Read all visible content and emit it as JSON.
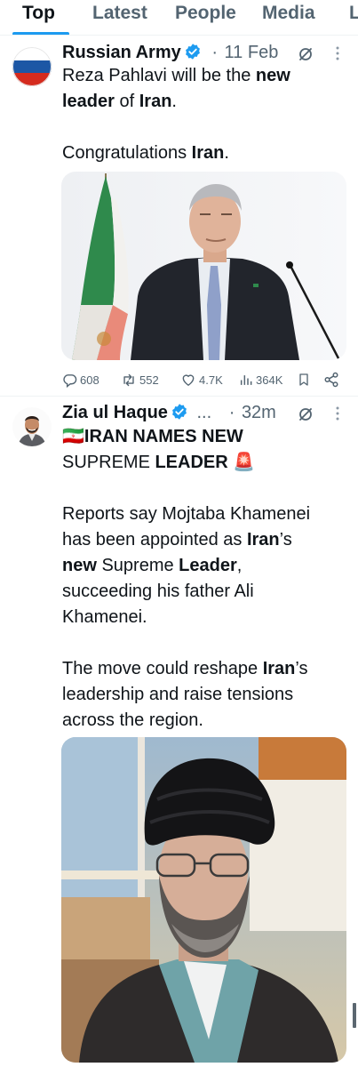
{
  "tabs": [
    {
      "label": "Top",
      "active": true
    },
    {
      "label": "Latest",
      "active": false
    },
    {
      "label": "People",
      "active": false
    },
    {
      "label": "Media",
      "active": false
    },
    {
      "label": "L",
      "active": false
    }
  ],
  "tweets": [
    {
      "author": "Russian Army",
      "verified": true,
      "separator": "·",
      "time": "11 Feb",
      "avatar": "russian-flag-avatar",
      "text_lines": [
        [
          {
            "t": "Reza Pahlavi will be the "
          },
          {
            "t": "new",
            "b": true
          }
        ],
        [
          {
            "t": "leader",
            "b": true
          },
          {
            "t": " of "
          },
          {
            "t": "Iran",
            "b": true
          },
          {
            "t": "."
          }
        ],
        [],
        [
          {
            "t": "Congratulations "
          },
          {
            "t": "Iran",
            "b": true
          },
          {
            "t": "."
          }
        ]
      ],
      "media": "photo-man-in-suit-at-podium-with-iranian-flag",
      "actions": {
        "replies": "608",
        "reposts": "552",
        "likes": "4.7K",
        "views": "364K"
      }
    },
    {
      "author": "Zia ul Haque",
      "verified": true,
      "truncation": "...",
      "separator": "·",
      "time": "32m",
      "avatar": "man-with-beard-avatar",
      "text_lines": [
        [
          {
            "t": "🇮🇷"
          },
          {
            "t": "IRAN NAMES NEW",
            "b": true
          }
        ],
        [
          {
            "t": "SUPREME "
          },
          {
            "t": "LEADER",
            "b": true
          },
          {
            "t": " 🚨"
          }
        ],
        [],
        [
          {
            "t": "Reports say Mojtaba Khamenei"
          }
        ],
        [
          {
            "t": "has been appointed as "
          },
          {
            "t": "Iran",
            "b": true
          },
          {
            "t": "’s"
          }
        ],
        [
          {
            "t": "new",
            "b": true
          },
          {
            "t": " Supreme "
          },
          {
            "t": "Leader",
            "b": true
          },
          {
            "t": ","
          }
        ],
        [
          {
            "t": "succeeding his father Ali"
          }
        ],
        [
          {
            "t": "Khamenei."
          }
        ],
        [],
        [
          {
            "t": "The move could reshape "
          },
          {
            "t": "Iran",
            "b": true
          },
          {
            "t": "’s"
          }
        ],
        [
          {
            "t": "leadership and raise tensions"
          }
        ],
        [
          {
            "t": "across the region."
          }
        ]
      ],
      "media": "photo-cleric-in-black-turban-and-glasses"
    }
  ],
  "colors": {
    "accent": "#1d9bf0",
    "text": "#0f1419",
    "secondary": "#536471"
  }
}
